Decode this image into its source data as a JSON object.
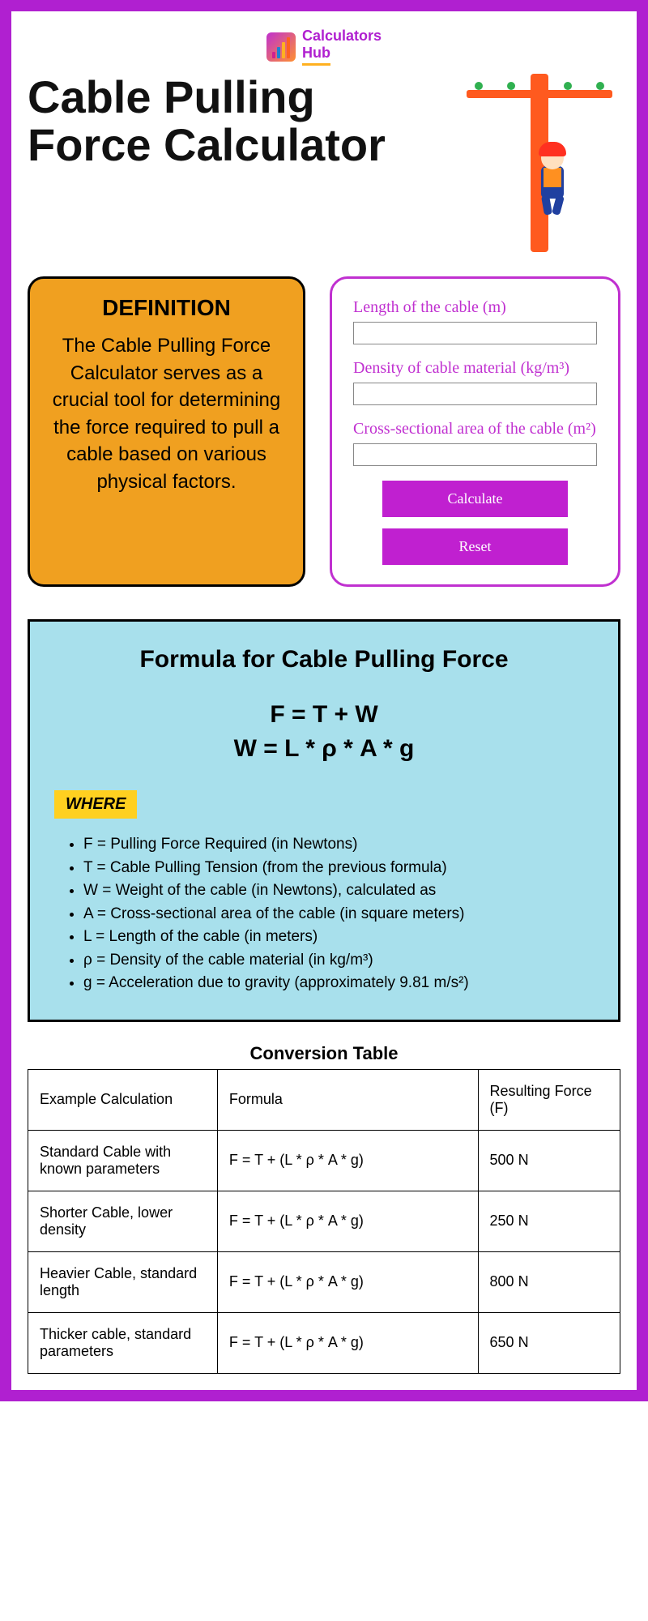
{
  "logo": {
    "line1": "Calculators",
    "line2": "Hub"
  },
  "title": "Cable Pulling Force Calculator",
  "definition": {
    "heading": "DEFINITION",
    "text": "The Cable Pulling Force Calculator serves as a crucial tool for determining the force required to pull a cable based on various physical factors."
  },
  "calc": {
    "length_label": "Length of the cable (m)",
    "density_label": "Density of cable material (kg/m³)",
    "area_label": "Cross-sectional area of the cable (m²)",
    "calculate_btn": "Calculate",
    "reset_btn": "Reset"
  },
  "formula": {
    "heading": "Formula for Cable Pulling Force",
    "eq1": "F = T + W",
    "eq2": "W = L * ρ * A * g",
    "where_tag": "WHERE",
    "items": [
      "F = Pulling Force Required (in Newtons)",
      "T = Cable Pulling Tension (from the previous formula)",
      "W = Weight of the cable (in Newtons), calculated as",
      "A = Cross-sectional area of the cable (in square meters)",
      "L = Length of the cable (in meters)",
      "ρ = Density of the cable material (in kg/m³)",
      "g = Acceleration due to gravity (approximately 9.81 m/s²)"
    ]
  },
  "table": {
    "title": "Conversion Table",
    "headers": {
      "c0": "Example Calculation",
      "c1": "Formula",
      "c2": "Resulting Force (F)"
    },
    "rows": [
      {
        "c0": "Standard Cable with known parameters",
        "c1": "F = T + (L * ρ * A * g)",
        "c2": "500 N"
      },
      {
        "c0": "Shorter Cable, lower density",
        "c1": "F = T + (L * ρ * A * g)",
        "c2": "250 N"
      },
      {
        "c0": "Heavier Cable, standard length",
        "c1": "F = T + (L * ρ * A * g)",
        "c2": "800 N"
      },
      {
        "c0": "Thicker cable, standard parameters",
        "c1": "F = T + (L * ρ * A * g)",
        "c2": "650 N"
      }
    ]
  }
}
